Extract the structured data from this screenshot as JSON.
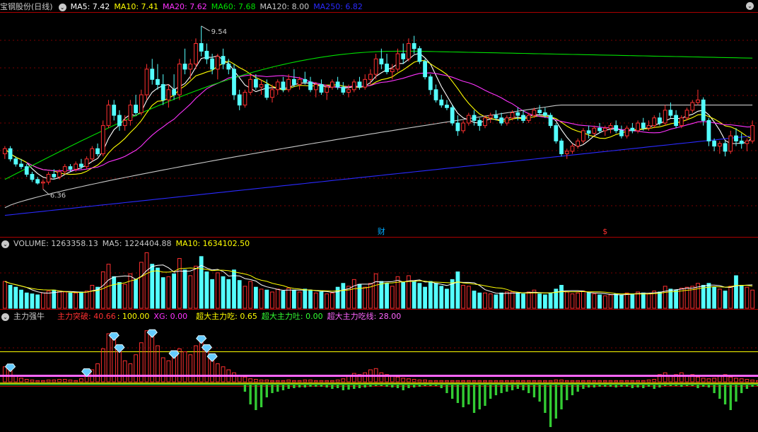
{
  "colors": {
    "up": "#ff3030",
    "down": "#54ffff",
    "ma5": "#ffffff",
    "ma10": "#ffff00",
    "ma20": "#ff33ff",
    "ma60": "#00e000",
    "ma120": "#c8c8c8",
    "ma250": "#2a2aff",
    "grid": "#7a0000",
    "label": "#c8c8c8",
    "xg": "#ff33ff",
    "line_yellow": "#ffff00",
    "line_pink": "#ff66ff",
    "absorb": "#ff3030",
    "spit": "#33cc33",
    "note_blue": "#00aaff"
  },
  "price_panel": {
    "title": "宝钢股份(日线)",
    "legend": [
      {
        "text": "MA5: 7.42",
        "color": "#ffffff"
      },
      {
        "text": "MA10: 7.41",
        "color": "#ffff00"
      },
      {
        "text": "MA20: 7.62",
        "color": "#ff33ff"
      },
      {
        "text": "MA60: 7.68",
        "color": "#00e000"
      },
      {
        "text": "MA120: 8.00",
        "color": "#c8c8c8"
      },
      {
        "text": "MA250: 6.82",
        "color": "#2a2aff"
      }
    ],
    "high_label": "9.54",
    "low_label": "6.36",
    "marker_cai": "财",
    "marker_dollar": "$"
  },
  "volume_panel": {
    "legend": [
      {
        "text": "VOLUME: 1263358.13",
        "color": "#c8c8c8"
      },
      {
        "text": "MA5: 1224404.88",
        "color": "#c8c8c8"
      },
      {
        "text": "MA10: 1634102.50",
        "color": "#ffff00"
      }
    ]
  },
  "indicator_panel": {
    "name": "主力强牛",
    "legend": [
      {
        "text": "主力突破: 40.66",
        "color": "#ff3030"
      },
      {
        "text": ": 100.00",
        "color": "#ffff00"
      },
      {
        "text": "XG: 0.00",
        "color": "#ff33ff"
      },
      {
        "text": "超大主力吃: 0.65",
        "color": "#ffff00"
      },
      {
        "text": "超大主力吐: 0.00",
        "color": "#33ff33"
      },
      {
        "text": "超大主力吃线: 28.00",
        "color": "#ff66ff"
      }
    ]
  },
  "chart_data": {
    "type": "candlestick",
    "title": "宝钢股份(日线)",
    "price_range": [
      5.5,
      9.8
    ],
    "candles": [
      [
        7.05,
        7.2,
        6.95,
        7.15
      ],
      [
        7.15,
        7.2,
        6.9,
        6.95
      ],
      [
        6.95,
        7.0,
        6.8,
        6.85
      ],
      [
        6.85,
        6.95,
        6.75,
        6.8
      ],
      [
        6.8,
        6.85,
        6.6,
        6.65
      ],
      [
        6.65,
        6.7,
        6.5,
        6.55
      ],
      [
        6.55,
        6.6,
        6.45,
        6.48
      ],
      [
        6.48,
        6.55,
        6.36,
        6.5
      ],
      [
        6.5,
        6.7,
        6.45,
        6.65
      ],
      [
        6.65,
        6.75,
        6.55,
        6.6
      ],
      [
        6.6,
        6.75,
        6.55,
        6.7
      ],
      [
        6.7,
        6.85,
        6.65,
        6.8
      ],
      [
        6.8,
        6.85,
        6.7,
        6.75
      ],
      [
        6.75,
        6.9,
        6.7,
        6.85
      ],
      [
        6.85,
        6.95,
        6.75,
        6.8
      ],
      [
        6.8,
        7.0,
        6.75,
        6.95
      ],
      [
        6.95,
        7.2,
        6.9,
        7.15
      ],
      [
        7.15,
        7.25,
        7.0,
        7.05
      ],
      [
        7.05,
        7.7,
        7.0,
        7.6
      ],
      [
        7.6,
        8.1,
        7.55,
        8.0
      ],
      [
        8.0,
        8.1,
        7.7,
        7.8
      ],
      [
        7.8,
        7.9,
        7.5,
        7.6
      ],
      [
        7.6,
        7.8,
        7.5,
        7.7
      ],
      [
        7.7,
        8.1,
        7.6,
        8.0
      ],
      [
        8.0,
        8.2,
        7.8,
        7.85
      ],
      [
        7.85,
        8.3,
        7.8,
        8.2
      ],
      [
        8.2,
        8.8,
        8.1,
        8.7
      ],
      [
        8.7,
        8.9,
        8.4,
        8.5
      ],
      [
        8.5,
        8.8,
        8.3,
        8.4
      ],
      [
        8.4,
        8.6,
        8.0,
        8.1
      ],
      [
        8.1,
        8.4,
        7.95,
        8.3
      ],
      [
        8.3,
        8.6,
        8.1,
        8.2
      ],
      [
        8.2,
        8.9,
        8.1,
        8.8
      ],
      [
        8.8,
        9.1,
        8.6,
        8.7
      ],
      [
        8.7,
        8.9,
        8.5,
        8.8
      ],
      [
        8.8,
        9.3,
        8.7,
        9.2
      ],
      [
        9.2,
        9.54,
        8.95,
        9.05
      ],
      [
        9.05,
        9.2,
        8.8,
        8.9
      ],
      [
        8.9,
        9.0,
        8.6,
        8.7
      ],
      [
        8.7,
        9.0,
        8.5,
        8.95
      ],
      [
        8.95,
        9.1,
        8.7,
        8.8
      ],
      [
        8.8,
        8.9,
        8.6,
        8.7
      ],
      [
        8.7,
        8.8,
        8.1,
        8.2
      ],
      [
        8.2,
        8.3,
        7.9,
        8.0
      ],
      [
        8.0,
        8.3,
        7.95,
        8.25
      ],
      [
        8.25,
        8.6,
        8.2,
        8.5
      ],
      [
        8.5,
        8.6,
        8.3,
        8.35
      ],
      [
        8.35,
        8.5,
        8.2,
        8.4
      ],
      [
        8.4,
        8.5,
        8.1,
        8.15
      ],
      [
        8.15,
        8.4,
        8.05,
        8.3
      ],
      [
        8.3,
        8.5,
        8.2,
        8.45
      ],
      [
        8.45,
        8.55,
        8.25,
        8.3
      ],
      [
        8.3,
        8.6,
        8.25,
        8.5
      ],
      [
        8.5,
        8.7,
        8.35,
        8.4
      ],
      [
        8.4,
        8.55,
        8.3,
        8.5
      ],
      [
        8.5,
        8.65,
        8.4,
        8.45
      ],
      [
        8.45,
        8.55,
        8.25,
        8.3
      ],
      [
        8.3,
        8.45,
        8.15,
        8.4
      ],
      [
        8.4,
        8.5,
        8.2,
        8.25
      ],
      [
        8.25,
        8.4,
        8.1,
        8.35
      ],
      [
        8.35,
        8.5,
        8.3,
        8.45
      ],
      [
        8.45,
        8.55,
        8.3,
        8.35
      ],
      [
        8.35,
        8.45,
        8.2,
        8.25
      ],
      [
        8.25,
        8.4,
        8.15,
        8.3
      ],
      [
        8.3,
        8.5,
        8.25,
        8.45
      ],
      [
        8.45,
        8.55,
        8.3,
        8.35
      ],
      [
        8.35,
        8.6,
        8.3,
        8.5
      ],
      [
        8.5,
        8.7,
        8.4,
        8.6
      ],
      [
        8.6,
        9.0,
        8.5,
        8.9
      ],
      [
        8.9,
        9.1,
        8.7,
        8.8
      ],
      [
        8.8,
        9.0,
        8.6,
        8.65
      ],
      [
        8.65,
        8.8,
        8.5,
        8.7
      ],
      [
        8.7,
        9.1,
        8.65,
        9.0
      ],
      [
        9.0,
        9.2,
        8.8,
        8.9
      ],
      [
        8.9,
        9.3,
        8.85,
        9.2
      ],
      [
        9.2,
        9.35,
        9.0,
        9.1
      ],
      [
        9.1,
        9.15,
        8.8,
        8.85
      ],
      [
        8.85,
        8.9,
        8.5,
        8.55
      ],
      [
        8.55,
        8.6,
        8.2,
        8.3
      ],
      [
        8.3,
        8.4,
        8.05,
        8.1
      ],
      [
        8.1,
        8.2,
        7.95,
        8.0
      ],
      [
        8.0,
        8.1,
        7.9,
        7.95
      ],
      [
        7.95,
        8.0,
        7.6,
        7.65
      ],
      [
        7.65,
        7.8,
        7.4,
        7.5
      ],
      [
        7.5,
        7.7,
        7.45,
        7.65
      ],
      [
        7.65,
        7.85,
        7.6,
        7.8
      ],
      [
        7.8,
        7.9,
        7.6,
        7.7
      ],
      [
        7.7,
        7.75,
        7.5,
        7.6
      ],
      [
        7.6,
        7.8,
        7.55,
        7.75
      ],
      [
        7.75,
        7.85,
        7.65,
        7.8
      ],
      [
        7.8,
        7.9,
        7.7,
        7.75
      ],
      [
        7.75,
        7.85,
        7.6,
        7.65
      ],
      [
        7.65,
        7.8,
        7.6,
        7.75
      ],
      [
        7.75,
        7.9,
        7.7,
        7.85
      ],
      [
        7.85,
        7.95,
        7.7,
        7.8
      ],
      [
        7.8,
        7.9,
        7.65,
        7.7
      ],
      [
        7.7,
        7.85,
        7.65,
        7.8
      ],
      [
        7.8,
        7.95,
        7.75,
        7.9
      ],
      [
        7.9,
        8.0,
        7.8,
        7.85
      ],
      [
        7.85,
        7.95,
        7.75,
        7.8
      ],
      [
        7.8,
        7.85,
        7.55,
        7.6
      ],
      [
        7.6,
        7.65,
        7.25,
        7.3
      ],
      [
        7.3,
        7.35,
        7.0,
        7.05
      ],
      [
        7.05,
        7.15,
        6.95,
        7.1
      ],
      [
        7.1,
        7.25,
        7.05,
        7.2
      ],
      [
        7.2,
        7.35,
        7.15,
        7.3
      ],
      [
        7.3,
        7.55,
        7.25,
        7.5
      ],
      [
        7.5,
        7.6,
        7.35,
        7.45
      ],
      [
        7.45,
        7.6,
        7.4,
        7.55
      ],
      [
        7.55,
        7.65,
        7.45,
        7.5
      ],
      [
        7.5,
        7.6,
        7.4,
        7.55
      ],
      [
        7.55,
        7.65,
        7.45,
        7.6
      ],
      [
        7.6,
        7.7,
        7.45,
        7.5
      ],
      [
        7.5,
        7.6,
        7.35,
        7.4
      ],
      [
        7.4,
        7.6,
        7.35,
        7.55
      ],
      [
        7.55,
        7.65,
        7.45,
        7.5
      ],
      [
        7.5,
        7.7,
        7.45,
        7.65
      ],
      [
        7.65,
        7.75,
        7.5,
        7.55
      ],
      [
        7.55,
        7.7,
        7.5,
        7.6
      ],
      [
        7.6,
        7.8,
        7.55,
        7.75
      ],
      [
        7.75,
        7.85,
        7.6,
        7.65
      ],
      [
        7.65,
        8.0,
        7.6,
        7.9
      ],
      [
        7.9,
        8.05,
        7.75,
        7.8
      ],
      [
        7.8,
        7.9,
        7.55,
        7.6
      ],
      [
        7.6,
        7.8,
        7.55,
        7.75
      ],
      [
        7.75,
        7.95,
        7.7,
        7.9
      ],
      [
        7.9,
        8.1,
        7.85,
        8.05
      ],
      [
        8.05,
        8.3,
        8.0,
        8.1
      ],
      [
        8.1,
        8.15,
        7.6,
        7.7
      ],
      [
        7.7,
        7.75,
        7.2,
        7.3
      ],
      [
        7.3,
        7.35,
        7.1,
        7.2
      ],
      [
        7.2,
        7.3,
        7.05,
        7.25
      ],
      [
        7.25,
        7.3,
        7.0,
        7.1
      ],
      [
        7.1,
        7.5,
        7.05,
        7.4
      ],
      [
        7.4,
        7.55,
        7.2,
        7.3
      ],
      [
        7.3,
        7.45,
        7.15,
        7.25
      ],
      [
        7.25,
        7.35,
        7.1,
        7.3
      ],
      [
        7.3,
        7.7,
        7.25,
        7.6
      ]
    ],
    "volume": [
      2.8,
      2.4,
      2.2,
      1.9,
      1.6,
      1.5,
      1.4,
      1.6,
      1.8,
      1.9,
      1.8,
      1.7,
      1.6,
      1.6,
      1.7,
      1.8,
      2.4,
      2.2,
      3.8,
      4.6,
      3.3,
      2.7,
      2.5,
      3.6,
      3.0,
      4.8,
      5.8,
      4.6,
      4.2,
      3.2,
      3.3,
      3.6,
      5.2,
      4.0,
      3.4,
      4.4,
      5.4,
      3.8,
      3.0,
      3.7,
      3.3,
      3.0,
      4.0,
      2.9,
      2.3,
      2.8,
      2.2,
      2.0,
      1.9,
      1.7,
      2.0,
      1.8,
      2.1,
      1.9,
      1.7,
      2.0,
      1.9,
      1.6,
      1.7,
      1.5,
      1.6,
      2.2,
      2.6,
      2.3,
      3.0,
      2.5,
      2.2,
      2.6,
      3.6,
      2.8,
      2.6,
      2.3,
      3.3,
      2.7,
      3.4,
      2.8,
      2.6,
      2.2,
      2.8,
      2.6,
      2.3,
      2.0,
      3.0,
      3.8,
      2.4,
      2.3,
      1.8,
      1.6,
      1.6,
      1.5,
      1.4,
      1.6,
      1.7,
      1.7,
      1.6,
      1.5,
      1.7,
      1.9,
      1.5,
      1.4,
      1.6,
      2.0,
      2.4,
      1.7,
      1.5,
      1.6,
      1.8,
      1.6,
      1.5,
      1.4,
      1.3,
      1.4,
      1.5,
      1.4,
      1.6,
      1.5,
      1.7,
      1.6,
      1.5,
      1.8,
      1.7,
      2.3,
      2.0,
      1.9,
      2.1,
      2.2,
      2.3,
      2.6,
      2.4,
      2.6,
      2.2,
      2.0,
      1.8,
      2.3,
      3.4,
      2.4,
      2.2,
      1.9
    ],
    "indicator_bars": [
      25,
      18,
      10,
      6,
      4,
      3,
      2,
      2,
      3,
      3,
      4,
      4,
      3,
      2,
      5,
      10,
      20,
      30,
      55,
      80,
      70,
      50,
      35,
      30,
      45,
      65,
      85,
      75,
      60,
      40,
      35,
      40,
      55,
      50,
      45,
      60,
      65,
      50,
      35,
      30,
      25,
      20,
      15,
      10,
      8,
      5,
      4,
      3,
      3,
      2,
      2,
      2,
      3,
      2,
      2,
      3,
      3,
      2,
      2,
      2,
      2,
      3,
      5,
      10,
      14,
      12,
      15,
      20,
      22,
      15,
      12,
      10,
      8,
      6,
      5,
      4,
      3,
      3,
      2,
      2,
      2,
      2,
      2,
      2,
      2,
      2,
      2,
      2,
      2,
      2,
      2,
      2,
      2,
      2,
      2,
      2,
      2,
      2,
      2,
      2,
      2,
      3,
      3,
      2,
      2,
      2,
      2,
      2,
      2,
      2,
      2,
      2,
      2,
      2,
      2,
      2,
      2,
      2,
      3,
      4,
      12,
      15,
      10,
      12,
      15,
      10,
      12,
      8,
      6,
      5,
      6,
      10,
      12,
      8,
      6,
      5,
      4,
      3,
      2,
      2,
      2,
      12
    ],
    "spit_bars": [
      0,
      0,
      0,
      0,
      0,
      0,
      0,
      0,
      0,
      0,
      0,
      0,
      0,
      0,
      0,
      0,
      0,
      0,
      0,
      0,
      0,
      0,
      0,
      0,
      0,
      0,
      0,
      0,
      0,
      0,
      0,
      0,
      0,
      0,
      0,
      0,
      0,
      0,
      0,
      0,
      0,
      0,
      0,
      0,
      10,
      28,
      36,
      32,
      18,
      12,
      10,
      8,
      6,
      5,
      4,
      4,
      3,
      3,
      3,
      4,
      6,
      5,
      8,
      7,
      6,
      5,
      4,
      3,
      2,
      2,
      3,
      4,
      5,
      8,
      5,
      4,
      3,
      2,
      2,
      2,
      5,
      12,
      20,
      26,
      32,
      28,
      40,
      35,
      30,
      20,
      15,
      12,
      10,
      8,
      6,
      8,
      12,
      18,
      24,
      40,
      60,
      48,
      35,
      22,
      15,
      10,
      6,
      4,
      4,
      3,
      3,
      3,
      4,
      3,
      3,
      5,
      4,
      5,
      3,
      6,
      4,
      2,
      2,
      2,
      3,
      2,
      2,
      5,
      3,
      4,
      12,
      20,
      28,
      36,
      24,
      12,
      6,
      3,
      2,
      2,
      2,
      2
    ],
    "xg_signals": [
      1,
      15,
      20,
      21,
      27,
      31,
      36,
      37,
      38
    ],
    "note_cai_index": 69,
    "note_dollar_index": 110
  }
}
